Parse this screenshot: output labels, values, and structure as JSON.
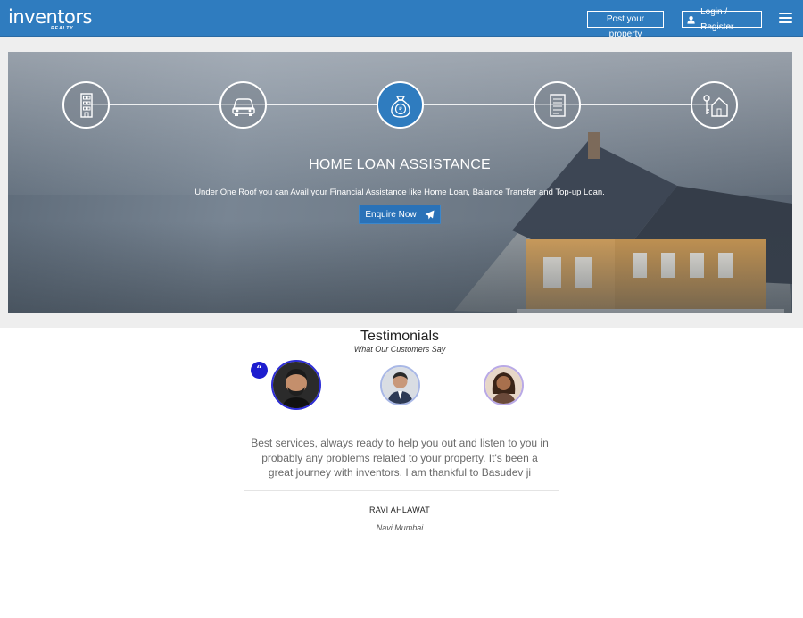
{
  "header": {
    "logo_text": "inventors",
    "logo_subtext": "REALTY",
    "post_property_label": "Post your property",
    "login_label": "Login / Register",
    "menu_icon": "hamburger-icon",
    "background_color": "#2f7cbf"
  },
  "hero": {
    "steps": [
      {
        "icon": "building-icon",
        "active": false
      },
      {
        "icon": "car-icon",
        "active": false
      },
      {
        "icon": "money-bag-icon",
        "active": true
      },
      {
        "icon": "document-icon",
        "active": false
      },
      {
        "icon": "house-key-icon",
        "active": false
      }
    ],
    "title": "HOME LOAN ASSISTANCE",
    "subtitle": "Under One Roof you can Avail your Financial Assistance like Home Loan, Balance Transfer and Top-up Loan.",
    "cta_label": "Enquire Now",
    "cta_icon": "paper-plane-icon",
    "accent_color": "#2a72b8"
  },
  "testimonials": {
    "title": "Testimonials",
    "subtitle": "What Our Customers Say",
    "quote_icon": "quote-icon",
    "quote_glyph": "“",
    "avatars": [
      {
        "name": "avatar-ravi",
        "active": true
      },
      {
        "name": "avatar-customer-2",
        "active": false
      },
      {
        "name": "avatar-customer-3",
        "active": false
      }
    ],
    "text": "Best services, always ready to help you out and listen to you in probably any problems related to your property. It's been a great journey with inventors. I am thankful to Basudev ji",
    "author": "RAVI AHLAWAT",
    "location": "Navi Mumbai"
  }
}
